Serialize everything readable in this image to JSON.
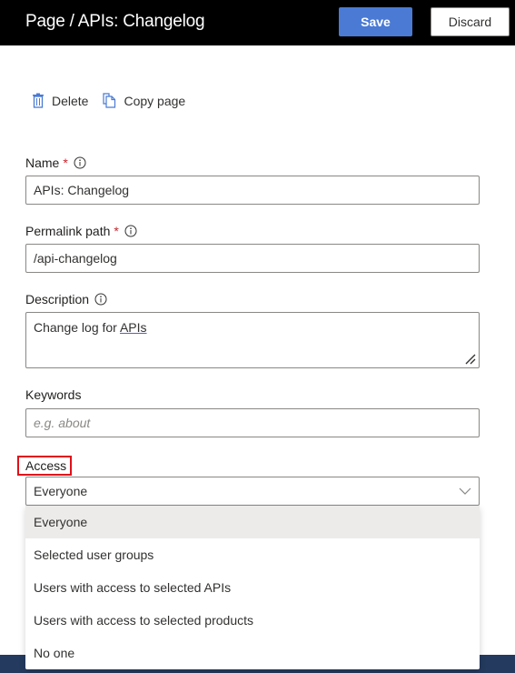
{
  "header": {
    "title": "Page / APIs: Changelog",
    "save_label": "Save",
    "discard_label": "Discard"
  },
  "actions": {
    "delete_label": "Delete",
    "copy_label": "Copy page"
  },
  "form": {
    "name": {
      "label": "Name",
      "required_mark": "*",
      "value": "APIs: Changelog"
    },
    "permalink": {
      "label": "Permalink path",
      "required_mark": "*",
      "value": "/api-changelog"
    },
    "description": {
      "label": "Description",
      "value_prefix": "Change log for ",
      "value_underlined": "APIs"
    },
    "keywords": {
      "label": "Keywords",
      "value": "",
      "placeholder": "e.g. about"
    },
    "access": {
      "label": "Access",
      "selected": "Everyone",
      "options": [
        "Everyone",
        "Selected user groups",
        "Users with access to selected APIs",
        "Users with access to selected products",
        "No one"
      ]
    }
  },
  "colors": {
    "header_bg": "#000000",
    "primary": "#4a7ad4",
    "required": "#c4262e",
    "highlight_box": "#e0101a",
    "selected_option_bg": "#edebe9"
  }
}
